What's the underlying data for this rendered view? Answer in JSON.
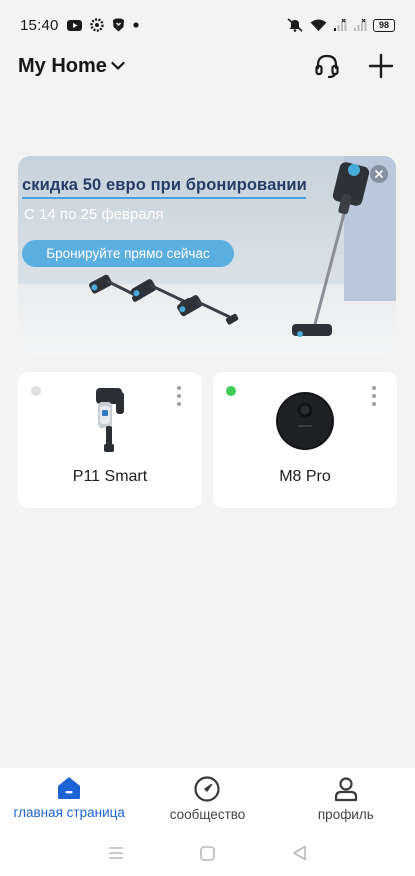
{
  "status_bar": {
    "time": "15:40",
    "battery": "98",
    "icons": [
      "youtube-icon",
      "app-icon",
      "brave-icon",
      "notification-dot-icon",
      "mute-icon",
      "wifi-icon",
      "signal-icon",
      "signal-icon"
    ]
  },
  "header": {
    "home_name": "My Home",
    "dropdown_icon": "chevron-down-icon",
    "support_icon": "headset-icon",
    "add_icon": "plus-icon"
  },
  "banner": {
    "headline": "скидка 50 евро при бронировании",
    "dates": "С 14 по 25 февраля",
    "cta": "Бронируйте прямо сейчас",
    "close_icon": "close-icon"
  },
  "devices": [
    {
      "name": "P11 Smart",
      "online": false,
      "status_color": "#e0e0e0",
      "image": "stick-vacuum"
    },
    {
      "name": "M8 Pro",
      "online": true,
      "status_color": "#3ecb56",
      "image": "robot-vacuum"
    }
  ],
  "bottom_nav": [
    {
      "label": "главная страница",
      "icon": "home-icon",
      "active": true
    },
    {
      "label": "сообщество",
      "icon": "compass-icon",
      "active": false
    },
    {
      "label": "профиль",
      "icon": "profile-icon",
      "active": false
    }
  ],
  "colors": {
    "accent": "#1e63d6",
    "background": "#f3f3f3",
    "card": "#ffffff",
    "banner_cta": "#5aaee0"
  }
}
